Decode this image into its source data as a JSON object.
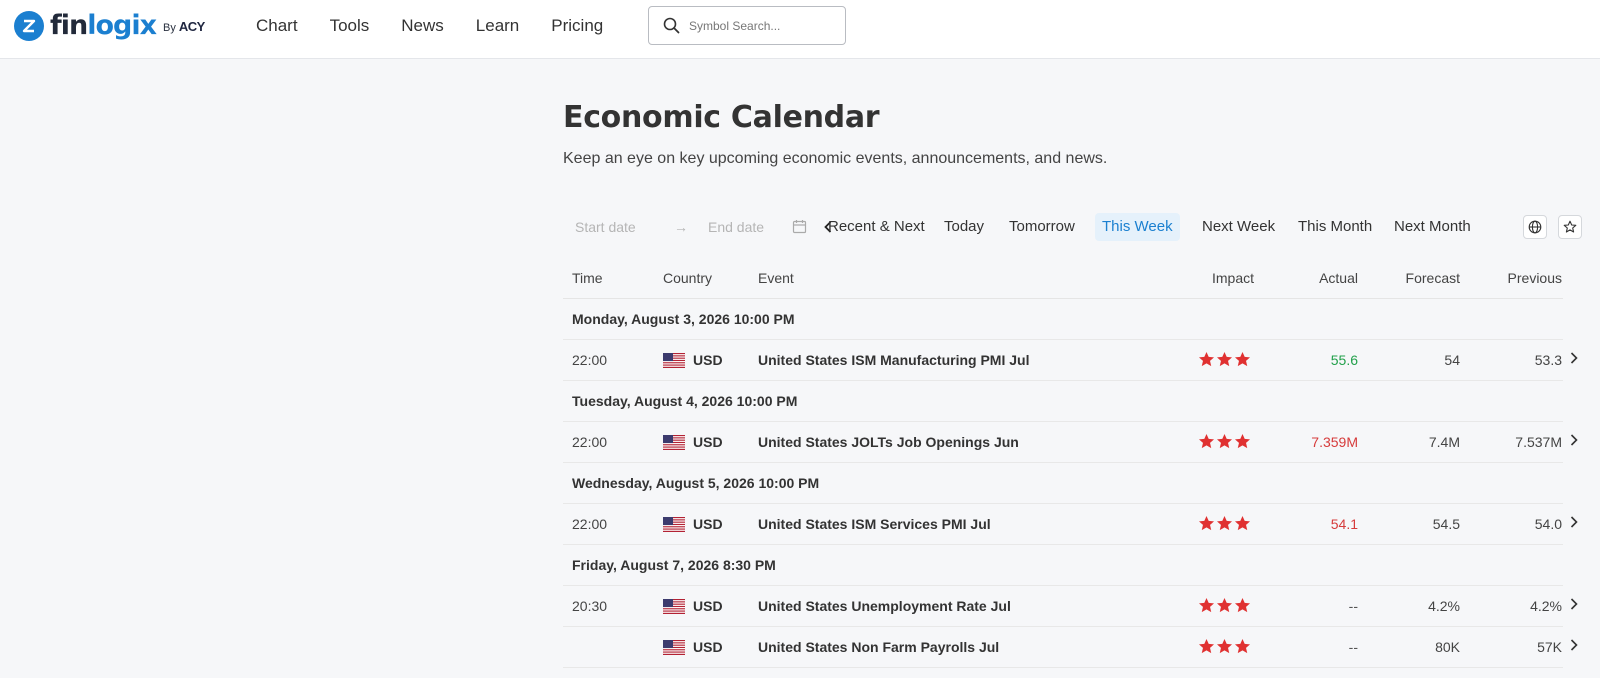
{
  "brand": {
    "logo_word_a": "fin",
    "logo_word_b": "logix",
    "by_label": "By",
    "by_brand": "ACY",
    "brand_color": "#1b7fd0"
  },
  "nav": {
    "items": [
      "Chart",
      "Tools",
      "News",
      "Learn",
      "Pricing"
    ]
  },
  "search": {
    "placeholder": "Symbol Search...",
    "icon": "search-icon"
  },
  "hero": {
    "title": "Economic Calendar",
    "subtitle": "Keep an eye on key upcoming economic events, announcements, and news."
  },
  "filters": {
    "start_placeholder": "Start date",
    "end_placeholder": "End date",
    "separator": "→",
    "quick": [
      "Recent & Next",
      "Today",
      "Tomorrow",
      "This Week",
      "Next Week",
      "This Month",
      "Next Month"
    ],
    "active": "This Week",
    "active_color": "#1b80d0"
  },
  "table": {
    "headers": {
      "time": "Time",
      "country": "Country",
      "event": "Event",
      "impact": "Impact",
      "actual": "Actual",
      "forecast": "Forecast",
      "previous": "Previous"
    },
    "groups": [
      {
        "date": "Monday, August 3, 2026 10:00 PM",
        "rows": [
          {
            "time": "22:00",
            "currency": "USD",
            "event": "United States ISM Manufacturing PMI Jul",
            "impact": 3,
            "actual": "55.6",
            "actual_trend": "green",
            "forecast": "54",
            "previous": "53.3"
          }
        ]
      },
      {
        "date": "Tuesday, August 4, 2026 10:00 PM",
        "rows": [
          {
            "time": "22:00",
            "currency": "USD",
            "event": "United States JOLTs Job Openings Jun",
            "impact": 3,
            "actual": "7.359M",
            "actual_trend": "red",
            "forecast": "7.4M",
            "previous": "7.537M"
          }
        ]
      },
      {
        "date": "Wednesday, August 5, 2026 10:00 PM",
        "rows": [
          {
            "time": "22:00",
            "currency": "USD",
            "event": "United States ISM Services PMI Jul",
            "impact": 3,
            "actual": "54.1",
            "actual_trend": "red",
            "forecast": "54.5",
            "previous": "54.0"
          }
        ]
      },
      {
        "date": "Friday, August 7, 2026 8:30 PM",
        "rows": [
          {
            "time": "20:30",
            "currency": "USD",
            "event": "United States Unemployment Rate Jul",
            "impact": 3,
            "actual": "--",
            "actual_trend": "none",
            "forecast": "4.2%",
            "previous": "4.2%"
          },
          {
            "time": "",
            "currency": "USD",
            "event": "United States Non Farm Payrolls Jul",
            "impact": 3,
            "actual": "--",
            "actual_trend": "none",
            "forecast": "80K",
            "previous": "57K"
          }
        ]
      }
    ]
  },
  "colors": {
    "star": "#e03131",
    "positive": "#22a04b",
    "negative": "#d63b3b"
  }
}
